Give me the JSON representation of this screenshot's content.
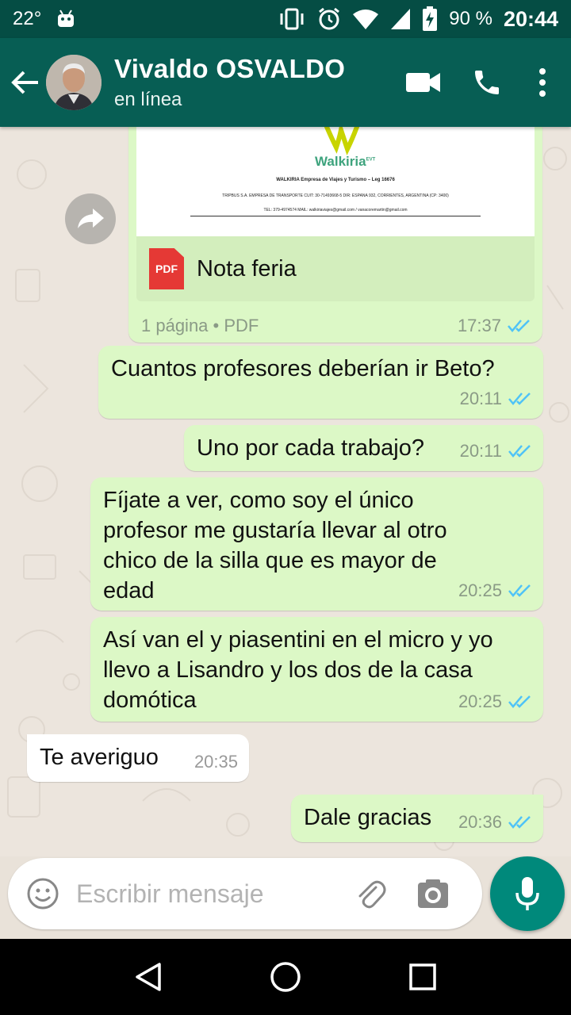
{
  "status_bar": {
    "temperature": "22°",
    "battery": "90 %",
    "time": "20:44",
    "icons": [
      "android-icon",
      "vibrate-icon",
      "alarm-icon",
      "wifi-icon",
      "signal-icon",
      "battery-charging-icon"
    ]
  },
  "header": {
    "contact_name": "Vivaldo OSVALDO",
    "contact_status": "en línea",
    "icons": [
      "back-arrow-icon",
      "video-call-icon",
      "phone-icon",
      "more-vert-icon"
    ],
    "colors": {
      "toolbar": "#075e54",
      "status_bar": "#054d44"
    }
  },
  "document": {
    "brand": "Walkiria",
    "brand_sup": "EVT",
    "line1": "WALKIRIA Empresa de Viajes y Turismo – Leg 16676",
    "line2": "TRIPBUS S.A. EMPRESA DE TRANSPORTE  CUIT: 30-71493668-5  DIR: ESPANA 932, CORRIENTES, ARGENTINA (CP: 3400)",
    "line3": "TEL: 379-4974574   MAIL: walkiriaviajes@gmail.com / vanacoremartin@gmail.com",
    "file_badge": "PDF",
    "file_name": "Nota feria",
    "info": "1 página • PDF",
    "time": "17:37"
  },
  "messages": [
    {
      "dir": "out",
      "text": "Cuantos profesores deberían ir Beto?",
      "time": "20:11"
    },
    {
      "dir": "out",
      "text": "Uno por cada trabajo?",
      "time": "20:11"
    },
    {
      "dir": "out",
      "lines": [
        "Fíjate a ver, como soy el único",
        "profesor me gustaría llevar al otro",
        "chico de la silla que es mayor de",
        "edad"
      ],
      "time": "20:25"
    },
    {
      "dir": "out",
      "lines": [
        "Así van el y piasentini en el micro y yo",
        "llevo a Lisandro y los dos de la casa",
        "domótica"
      ],
      "time": "20:25"
    },
    {
      "dir": "in",
      "text": "Te averiguo",
      "time": "20:35"
    },
    {
      "dir": "out",
      "text": "Dale gracias",
      "time": "20:36"
    }
  ],
  "composer": {
    "placeholder": "Escribir mensaje",
    "icons": [
      "emoji-icon",
      "attach-icon",
      "camera-icon",
      "mic-icon"
    ],
    "accent": "#00897b"
  },
  "navigation": {
    "icons": [
      "nav-back-icon",
      "nav-home-icon",
      "nav-recents-icon"
    ]
  },
  "colors": {
    "outgoing_bubble": "#dcf8c6",
    "incoming_bubble": "#ffffff",
    "read_ticks": "#4fc3f7"
  }
}
